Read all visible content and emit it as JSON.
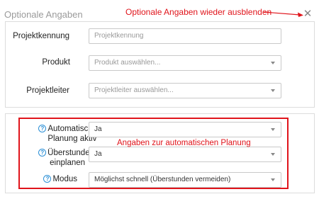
{
  "dialog": {
    "title": "Optionale Angaben",
    "close_label": "✕"
  },
  "annotations": {
    "hide_hint": "Optionale Angaben wieder ausblenden",
    "planning_hint": "Angaben zur automatischen Planung",
    "color": "#e0141b"
  },
  "fields": {
    "projektkennung": {
      "label": "Projektkennung",
      "placeholder": "Projektkennung"
    },
    "produkt": {
      "label": "Produkt",
      "placeholder": "Produkt auswählen..."
    },
    "projektleiter": {
      "label": "Projektleiter",
      "placeholder": "Projektleiter auswählen..."
    },
    "auto_planung": {
      "label_line1": "Automatische",
      "label_line2": "Planung aktiv",
      "value": "Ja"
    },
    "ueberstunden": {
      "label_line1": "Überstunden",
      "label_line2": "einplanen",
      "value": "Ja"
    },
    "modus": {
      "label": "Modus",
      "value": "Möglichst schnell (Überstunden vermeiden)"
    }
  },
  "help_icon": "?",
  "icons": {
    "close": "close-icon",
    "help": "help-icon",
    "dropdown": "chevron-down-icon"
  }
}
